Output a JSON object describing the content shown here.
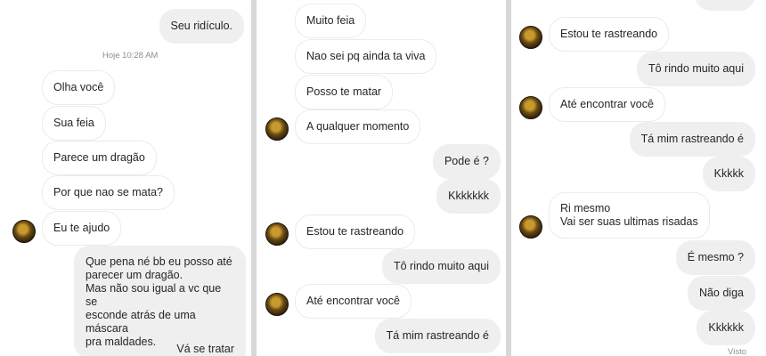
{
  "panel1": {
    "messages": [
      {
        "dir": "out",
        "text": "Seu ridículo."
      },
      {
        "dir": "in",
        "text": "Olha você"
      },
      {
        "dir": "in",
        "text": "Sua feia"
      },
      {
        "dir": "in",
        "text": "Parece um dragão"
      },
      {
        "dir": "in",
        "text": "Por que nao se mata?"
      },
      {
        "dir": "in",
        "text": "Eu te ajudo"
      },
      {
        "dir": "out",
        "text": "Que pena né bb eu posso até\nparecer um dragão.\nMas não sou igual a vc que se\nesconde atrás de uma máscara\npra maldades."
      },
      {
        "dir": "out",
        "text": "Vá se tratar"
      }
    ],
    "timestamp": "Hoje 10:28 AM"
  },
  "panel2": {
    "messages": [
      {
        "dir": "in",
        "text": "Muito feia"
      },
      {
        "dir": "in",
        "text": "Nao sei pq ainda ta viva"
      },
      {
        "dir": "in",
        "text": "Posso te matar"
      },
      {
        "dir": "in",
        "text": "A qualquer momento"
      },
      {
        "dir": "out",
        "text": "Pode é ?"
      },
      {
        "dir": "out",
        "text": "Kkkkkkk"
      },
      {
        "dir": "in",
        "text": "Estou te rastreando"
      },
      {
        "dir": "out",
        "text": "Tô rindo muito aqui"
      },
      {
        "dir": "in",
        "text": "Até encontrar você"
      },
      {
        "dir": "out",
        "text": "Tá mim rastreando é"
      }
    ]
  },
  "panel3": {
    "messages": [
      {
        "dir": "in",
        "text": "Estou te rastreando"
      },
      {
        "dir": "out",
        "text": "Tô rindo muito aqui"
      },
      {
        "dir": "in",
        "text": "Até encontrar você"
      },
      {
        "dir": "out",
        "text": "Tá mim rastreando é"
      },
      {
        "dir": "out",
        "text": "Kkkkk"
      },
      {
        "dir": "in",
        "text": "Ri mesmo\nVai ser suas ultimas risadas"
      },
      {
        "dir": "out",
        "text": "É mesmo ?"
      },
      {
        "dir": "out",
        "text": "Não diga"
      },
      {
        "dir": "out",
        "text": "Kkkkkk"
      }
    ],
    "seen_label": "Visto"
  }
}
